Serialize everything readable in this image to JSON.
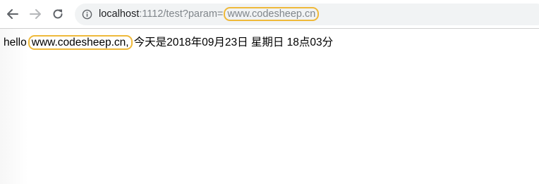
{
  "toolbar": {
    "back_icon": "back-arrow-icon",
    "forward_icon": "forward-arrow-icon",
    "reload_icon": "reload-icon",
    "info_icon": "info-circle-icon"
  },
  "address_bar": {
    "host": "localhost",
    "path": ":1112/test?param=",
    "param_value": "www.codesheep.cn",
    "highlight_color": "#efb93a"
  },
  "page": {
    "greeting": "hello",
    "param_echo": "www.codesheep.cn,",
    "date_text": "今天是2018年09月23日 星期日 18点03分"
  }
}
